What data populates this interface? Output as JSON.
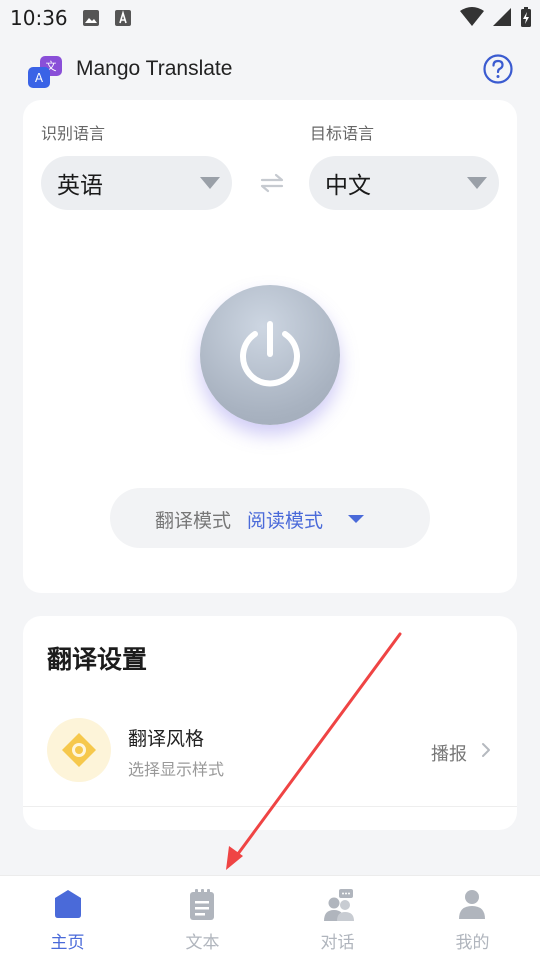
{
  "status_bar": {
    "time": "10:36",
    "icons": [
      "image-icon",
      "font-icon",
      "wifi-icon",
      "signal-icon",
      "battery-charging-icon"
    ]
  },
  "header": {
    "title": "Mango Translate",
    "logo_icon": "translate-logo-icon",
    "help_icon": "help-icon"
  },
  "translator": {
    "source_label": "识别语言",
    "source_value": "英语",
    "target_label": "目标语言",
    "target_value": "中文",
    "swap_icon": "swap-icon",
    "power_icon": "power-icon",
    "mode_label": "翻译模式",
    "mode_value": "阅读模式"
  },
  "settings": {
    "title": "翻译设置",
    "style_title": "翻译风格",
    "style_subtitle": "选择显示样式",
    "style_action": "播报"
  },
  "nav": [
    {
      "label": "主页",
      "icon": "home-icon",
      "active": true
    },
    {
      "label": "文本",
      "icon": "document-icon",
      "active": false
    },
    {
      "label": "对话",
      "icon": "conversation-icon",
      "active": false
    },
    {
      "label": "我的",
      "icon": "profile-icon",
      "active": false
    }
  ],
  "colors": {
    "accent": "#4a6ad9",
    "nav_active": "#4a6ad9",
    "nav_inactive": "#b0b5bd",
    "annotation_arrow": "#ef4444"
  }
}
